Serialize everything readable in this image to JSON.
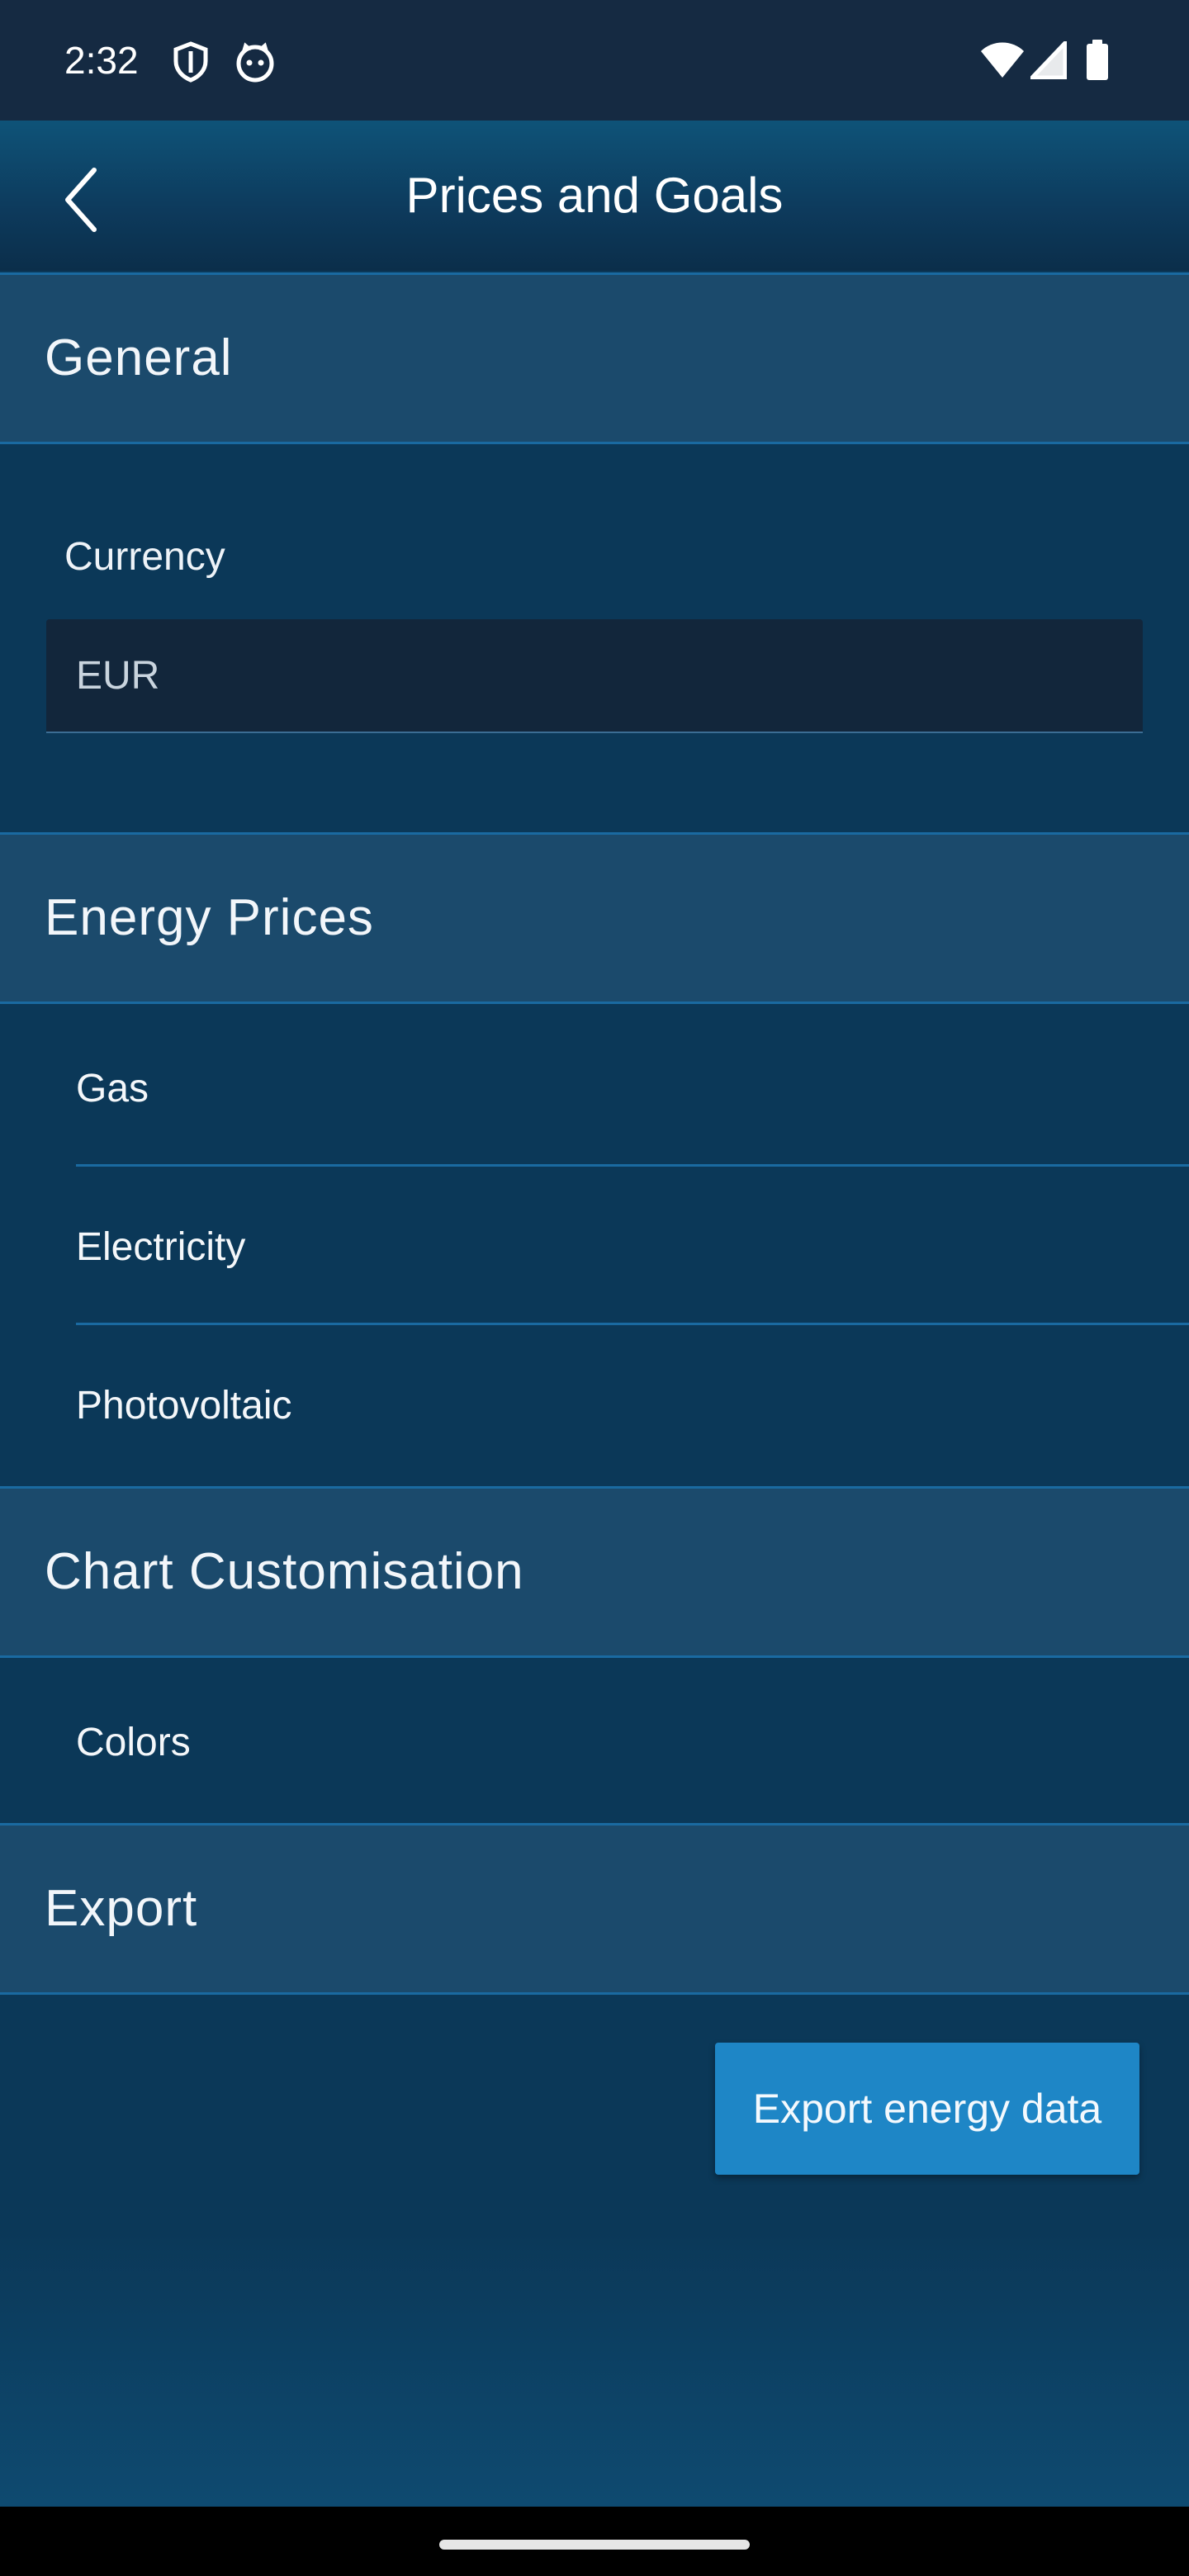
{
  "status_bar": {
    "time": "2:32",
    "left_icons": [
      "shield-icon",
      "cat-face-icon"
    ],
    "right_icons": [
      "wifi-icon",
      "cellular-signal-icon",
      "battery-icon"
    ]
  },
  "app_bar": {
    "title": "Prices and Goals",
    "back_icon": "chevron-left-icon"
  },
  "sections": {
    "general": {
      "title": "General",
      "currency_label": "Currency",
      "currency_value": "EUR"
    },
    "energy_prices": {
      "title": "Energy Prices",
      "items": [
        {
          "label": "Gas"
        },
        {
          "label": "Electricity"
        },
        {
          "label": "Photovoltaic"
        }
      ]
    },
    "chart_customisation": {
      "title": "Chart Customisation",
      "items": [
        {
          "label": "Colors"
        }
      ]
    },
    "export": {
      "title": "Export",
      "button_label": "Export energy data"
    }
  },
  "colors": {
    "background": "#0b3858",
    "section_header": "#1b4a6c",
    "divider": "#1a6aa1",
    "button": "#1e86c6"
  }
}
